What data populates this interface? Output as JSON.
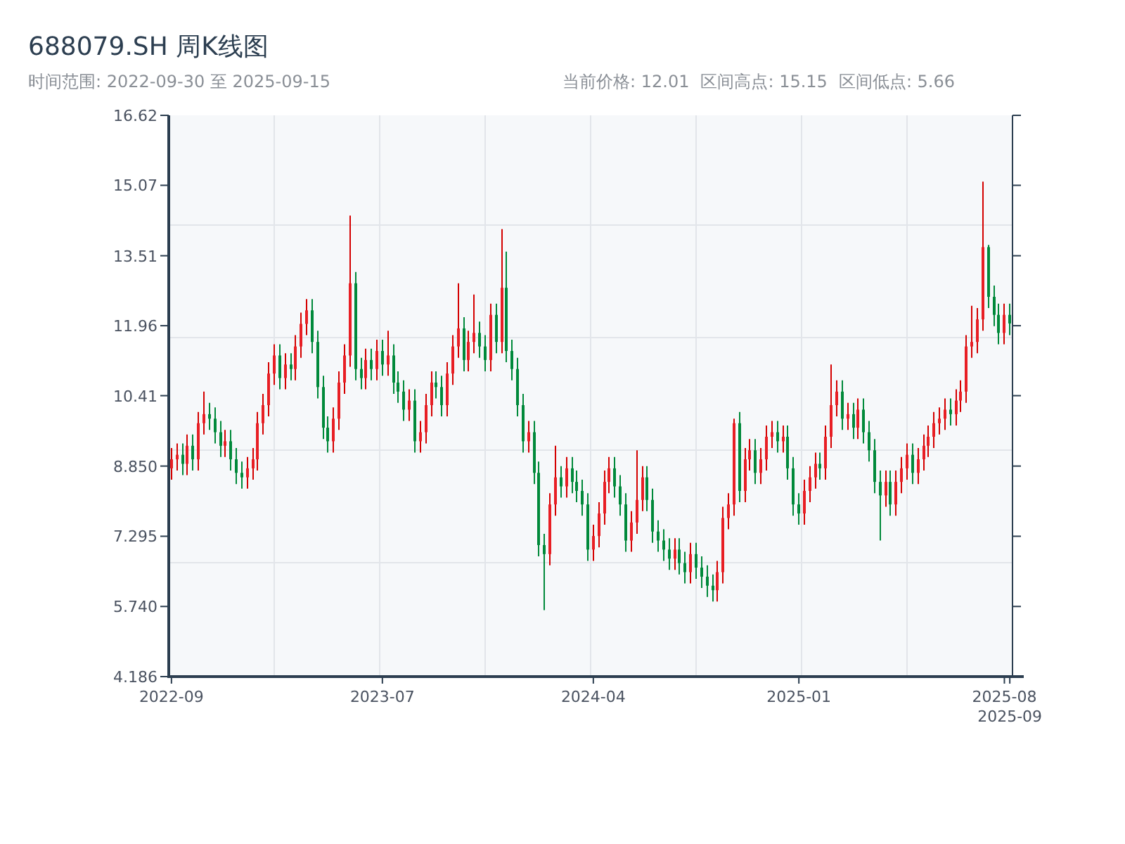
{
  "title": "688079.SH 周K线图",
  "range": "时间范围: 2022-09-30 至 2025-09-15",
  "stats": [
    "当前价格: 12.01",
    "区间高点: 15.15",
    "区间低点: 5.66"
  ],
  "chart": {
    "chart_data": {
      "type": "candlestick",
      "ylim": [
        4.186,
        16.62
      ],
      "yticks": [
        {
          "value": 4.186,
          "label": "4.186"
        },
        {
          "value": 5.74,
          "label": "5.740"
        },
        {
          "value": 7.295,
          "label": "7.295"
        },
        {
          "value": 8.85,
          "label": "8.850"
        },
        {
          "value": 10.41,
          "label": "10.41"
        },
        {
          "value": 11.96,
          "label": "11.96"
        },
        {
          "value": 13.51,
          "label": "13.51"
        },
        {
          "value": 15.07,
          "label": "15.07"
        },
        {
          "value": 16.62,
          "label": "16.62"
        }
      ],
      "categories": [
        "2022-09",
        null,
        null,
        null,
        null,
        null,
        null,
        null,
        null,
        null,
        null,
        null,
        null,
        null,
        null,
        null,
        null,
        null,
        null,
        null,
        null,
        null,
        null,
        null,
        null,
        null,
        null,
        null,
        null,
        null,
        null,
        null,
        null,
        null,
        null,
        null,
        null,
        null,
        null,
        "2023-07",
        null,
        null,
        null,
        null,
        null,
        null,
        null,
        null,
        null,
        null,
        null,
        null,
        null,
        null,
        null,
        null,
        null,
        null,
        null,
        null,
        null,
        null,
        null,
        null,
        null,
        null,
        null,
        null,
        null,
        null,
        null,
        null,
        null,
        null,
        null,
        null,
        null,
        null,
        "2024-04",
        null,
        null,
        null,
        null,
        null,
        null,
        null,
        null,
        null,
        null,
        null,
        null,
        null,
        null,
        null,
        null,
        null,
        null,
        null,
        null,
        null,
        null,
        null,
        null,
        null,
        null,
        null,
        null,
        null,
        null,
        null,
        null,
        null,
        null,
        null,
        null,
        null,
        "2025-01",
        null,
        null,
        null,
        null,
        null,
        null,
        null,
        null,
        null,
        null,
        null,
        null,
        null,
        null,
        null,
        null,
        null,
        null,
        null,
        null,
        null,
        null,
        null,
        null,
        null,
        null,
        null,
        null,
        null,
        null,
        null,
        null,
        null,
        null,
        null,
        null,
        null,
        "2025-08",
        "2025-09"
      ],
      "ohlc": [
        [
          8.8,
          9.25,
          8.55,
          9.0
        ],
        [
          9.0,
          9.35,
          8.75,
          9.1
        ],
        [
          9.1,
          9.35,
          8.65,
          8.9
        ],
        [
          8.9,
          9.55,
          8.65,
          9.3
        ],
        [
          9.3,
          9.55,
          8.75,
          9.0
        ],
        [
          9.0,
          10.05,
          8.75,
          9.8
        ],
        [
          9.8,
          10.5,
          9.55,
          10.0
        ],
        [
          10.0,
          10.25,
          9.65,
          9.9
        ],
        [
          9.9,
          10.15,
          9.35,
          9.6
        ],
        [
          9.6,
          9.85,
          9.05,
          9.3
        ],
        [
          9.3,
          9.65,
          9.05,
          9.4
        ],
        [
          9.4,
          9.65,
          8.75,
          9.0
        ],
        [
          9.0,
          9.25,
          8.45,
          8.7
        ],
        [
          8.7,
          8.95,
          8.35,
          8.6
        ],
        [
          8.6,
          9.05,
          8.35,
          8.8
        ],
        [
          8.8,
          9.25,
          8.55,
          9.0
        ],
        [
          9.0,
          10.05,
          8.75,
          9.8
        ],
        [
          9.8,
          10.45,
          9.55,
          10.2
        ],
        [
          10.2,
          11.15,
          9.95,
          10.9
        ],
        [
          10.9,
          11.55,
          10.65,
          11.3
        ],
        [
          11.3,
          11.55,
          10.55,
          10.8
        ],
        [
          10.8,
          11.35,
          10.55,
          11.1
        ],
        [
          11.1,
          11.35,
          10.75,
          11.0
        ],
        [
          11.0,
          11.75,
          10.75,
          11.5
        ],
        [
          11.5,
          12.25,
          11.25,
          12.0
        ],
        [
          12.0,
          12.55,
          11.75,
          12.3
        ],
        [
          12.3,
          12.55,
          11.35,
          11.6
        ],
        [
          11.6,
          11.85,
          10.35,
          10.6
        ],
        [
          10.6,
          10.85,
          9.45,
          9.7
        ],
        [
          9.7,
          9.95,
          9.15,
          9.4
        ],
        [
          9.4,
          10.15,
          9.15,
          9.9
        ],
        [
          9.9,
          10.95,
          9.65,
          10.7
        ],
        [
          10.7,
          11.55,
          10.45,
          11.3
        ],
        [
          11.3,
          14.4,
          11.05,
          12.9
        ],
        [
          12.9,
          13.15,
          10.75,
          11.0
        ],
        [
          11.0,
          11.25,
          10.55,
          10.8
        ],
        [
          10.8,
          11.45,
          10.55,
          11.2
        ],
        [
          11.2,
          11.45,
          10.75,
          11.0
        ],
        [
          11.0,
          11.65,
          10.75,
          11.4
        ],
        [
          11.4,
          11.65,
          10.85,
          11.1
        ],
        [
          11.1,
          11.85,
          10.85,
          11.3
        ],
        [
          11.3,
          11.55,
          10.45,
          10.7
        ],
        [
          10.7,
          10.95,
          10.25,
          10.5
        ],
        [
          10.5,
          10.75,
          9.85,
          10.1
        ],
        [
          10.1,
          10.55,
          9.85,
          10.3
        ],
        [
          10.3,
          10.55,
          9.15,
          9.4
        ],
        [
          9.4,
          9.85,
          9.15,
          9.6
        ],
        [
          9.6,
          10.45,
          9.35,
          10.2
        ],
        [
          10.2,
          10.95,
          9.95,
          10.7
        ],
        [
          10.7,
          10.95,
          10.35,
          10.6
        ],
        [
          10.6,
          10.85,
          9.95,
          10.2
        ],
        [
          10.2,
          11.15,
          9.95,
          10.9
        ],
        [
          10.9,
          11.75,
          10.65,
          11.5
        ],
        [
          11.5,
          12.9,
          11.25,
          11.9
        ],
        [
          11.9,
          12.15,
          10.95,
          11.2
        ],
        [
          11.2,
          11.85,
          10.95,
          11.6
        ],
        [
          11.6,
          12.65,
          11.35,
          11.8
        ],
        [
          11.8,
          12.05,
          11.25,
          11.5
        ],
        [
          11.5,
          11.75,
          10.95,
          11.2
        ],
        [
          11.2,
          12.45,
          10.95,
          12.2
        ],
        [
          12.2,
          12.45,
          11.35,
          11.6
        ],
        [
          11.6,
          14.1,
          11.35,
          12.8
        ],
        [
          12.8,
          13.6,
          11.15,
          11.4
        ],
        [
          11.4,
          11.65,
          10.75,
          11.0
        ],
        [
          11.0,
          11.25,
          9.95,
          10.2
        ],
        [
          10.2,
          10.45,
          9.15,
          9.4
        ],
        [
          9.4,
          9.85,
          9.15,
          9.6
        ],
        [
          9.6,
          9.85,
          8.45,
          8.7
        ],
        [
          8.7,
          8.95,
          6.85,
          7.1
        ],
        [
          7.1,
          7.35,
          5.66,
          6.9
        ],
        [
          6.9,
          8.25,
          6.65,
          8.0
        ],
        [
          8.0,
          9.3,
          7.75,
          8.6
        ],
        [
          8.6,
          8.85,
          8.15,
          8.4
        ],
        [
          8.4,
          9.05,
          8.15,
          8.8
        ],
        [
          8.8,
          9.05,
          8.25,
          8.5
        ],
        [
          8.5,
          8.75,
          8.05,
          8.3
        ],
        [
          8.3,
          8.55,
          7.75,
          8.0
        ],
        [
          8.0,
          8.25,
          6.75,
          7.0
        ],
        [
          7.0,
          7.55,
          6.75,
          7.3
        ],
        [
          7.3,
          8.05,
          7.05,
          7.8
        ],
        [
          7.8,
          8.75,
          7.55,
          8.5
        ],
        [
          8.5,
          9.05,
          8.25,
          8.8
        ],
        [
          8.8,
          9.05,
          8.15,
          8.4
        ],
        [
          8.4,
          8.65,
          7.75,
          8.0
        ],
        [
          8.0,
          8.25,
          6.95,
          7.2
        ],
        [
          7.2,
          7.85,
          6.95,
          7.6
        ],
        [
          7.6,
          9.2,
          7.35,
          8.1
        ],
        [
          8.1,
          8.85,
          7.85,
          8.6
        ],
        [
          8.6,
          8.85,
          7.85,
          8.1
        ],
        [
          8.1,
          8.35,
          7.15,
          7.4
        ],
        [
          7.4,
          7.65,
          6.95,
          7.2
        ],
        [
          7.2,
          7.45,
          6.75,
          7.0
        ],
        [
          7.0,
          7.25,
          6.55,
          6.8
        ],
        [
          6.8,
          7.25,
          6.55,
          7.0
        ],
        [
          7.0,
          7.25,
          6.45,
          6.7
        ],
        [
          6.7,
          6.95,
          6.25,
          6.5
        ],
        [
          6.5,
          7.15,
          6.25,
          6.9
        ],
        [
          6.9,
          7.15,
          6.35,
          6.6
        ],
        [
          6.6,
          6.85,
          6.15,
          6.4
        ],
        [
          6.4,
          6.65,
          5.95,
          6.2
        ],
        [
          6.2,
          6.45,
          5.85,
          6.1
        ],
        [
          6.1,
          6.75,
          5.85,
          6.5
        ],
        [
          6.5,
          7.95,
          6.25,
          7.7
        ],
        [
          7.7,
          8.25,
          7.45,
          8.0
        ],
        [
          8.0,
          9.9,
          7.75,
          9.8
        ],
        [
          9.8,
          10.05,
          8.05,
          8.3
        ],
        [
          8.3,
          9.25,
          8.05,
          9.0
        ],
        [
          9.0,
          9.45,
          8.75,
          9.2
        ],
        [
          9.2,
          9.45,
          8.45,
          8.7
        ],
        [
          8.7,
          9.25,
          8.45,
          9.0
        ],
        [
          9.0,
          9.75,
          8.75,
          9.5
        ],
        [
          9.5,
          9.85,
          9.25,
          9.6
        ],
        [
          9.6,
          9.85,
          9.15,
          9.4
        ],
        [
          9.4,
          9.75,
          9.15,
          9.5
        ],
        [
          9.5,
          9.75,
          8.55,
          8.8
        ],
        [
          8.8,
          9.05,
          7.75,
          8.0
        ],
        [
          8.0,
          8.25,
          7.55,
          7.8
        ],
        [
          7.8,
          8.55,
          7.55,
          8.3
        ],
        [
          8.3,
          8.85,
          8.05,
          8.6
        ],
        [
          8.6,
          9.15,
          8.35,
          8.9
        ],
        [
          8.9,
          9.15,
          8.55,
          8.8
        ],
        [
          8.8,
          9.75,
          8.55,
          9.5
        ],
        [
          9.5,
          11.1,
          9.25,
          10.2
        ],
        [
          10.2,
          10.75,
          9.95,
          10.5
        ],
        [
          10.5,
          10.75,
          9.65,
          9.9
        ],
        [
          9.9,
          10.25,
          9.65,
          10.0
        ],
        [
          10.0,
          10.25,
          9.45,
          9.7
        ],
        [
          9.7,
          10.35,
          9.45,
          10.1
        ],
        [
          10.1,
          10.35,
          9.35,
          9.6
        ],
        [
          9.6,
          9.85,
          8.95,
          9.2
        ],
        [
          9.2,
          9.45,
          8.25,
          8.5
        ],
        [
          8.5,
          8.75,
          7.2,
          8.2
        ],
        [
          8.2,
          8.75,
          7.95,
          8.5
        ],
        [
          8.5,
          8.75,
          7.75,
          8.0
        ],
        [
          8.0,
          8.75,
          7.75,
          8.5
        ],
        [
          8.5,
          9.05,
          8.25,
          8.8
        ],
        [
          8.8,
          9.35,
          8.55,
          9.1
        ],
        [
          9.1,
          9.35,
          8.45,
          8.7
        ],
        [
          8.7,
          9.25,
          8.45,
          9.0
        ],
        [
          9.0,
          9.55,
          8.75,
          9.3
        ],
        [
          9.3,
          9.75,
          9.05,
          9.5
        ],
        [
          9.5,
          10.05,
          9.25,
          9.8
        ],
        [
          9.8,
          10.15,
          9.55,
          9.9
        ],
        [
          9.9,
          10.35,
          9.65,
          10.1
        ],
        [
          10.1,
          10.35,
          9.75,
          10.0
        ],
        [
          10.0,
          10.55,
          9.75,
          10.3
        ],
        [
          10.3,
          10.75,
          10.05,
          10.5
        ],
        [
          10.5,
          11.75,
          10.25,
          11.5
        ],
        [
          11.5,
          12.4,
          11.25,
          11.6
        ],
        [
          11.6,
          12.35,
          11.35,
          12.1
        ],
        [
          12.1,
          15.15,
          11.85,
          13.7
        ],
        [
          13.7,
          13.75,
          12.35,
          12.6
        ],
        [
          12.6,
          12.85,
          11.95,
          12.2
        ],
        [
          12.2,
          12.45,
          11.55,
          11.8
        ],
        [
          11.8,
          12.45,
          11.55,
          12.2
        ],
        [
          12.2,
          12.45,
          11.75,
          12.01
        ]
      ]
    }
  }
}
